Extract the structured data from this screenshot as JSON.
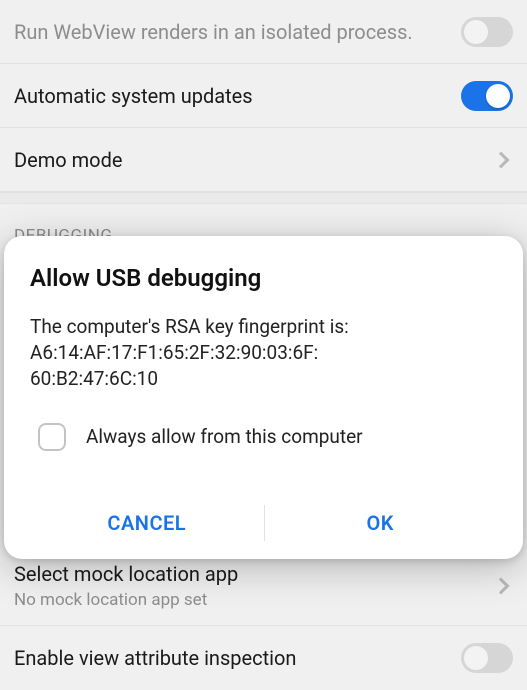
{
  "settings": {
    "rows": [
      {
        "title": "Run WebView renders in an isolated process.",
        "type": "toggle",
        "on": false,
        "dimmed": true
      },
      {
        "title": "Automatic system updates",
        "type": "toggle",
        "on": true
      },
      {
        "title": "Demo mode",
        "type": "nav"
      }
    ],
    "debug_section_label": "DEBUGGING",
    "debug_rows": [
      {
        "title": "Select mock location app",
        "subtitle": "No mock location app set",
        "type": "nav"
      },
      {
        "title": "Enable view attribute inspection",
        "type": "toggle",
        "on": false,
        "dimmed": true
      }
    ]
  },
  "dialog": {
    "title": "Allow USB debugging",
    "body_intro": "The computer's RSA key fingerprint is:",
    "fingerprint_line1": "A6:14:AF:17:F1:65:2F:32:90:03:6F:",
    "fingerprint_line2": "60:B2:47:6C:10",
    "checkbox_label": "Always allow from this computer",
    "checkbox_checked": false,
    "cancel_label": "CANCEL",
    "ok_label": "OK"
  },
  "colors": {
    "accent": "#1a73e8"
  }
}
